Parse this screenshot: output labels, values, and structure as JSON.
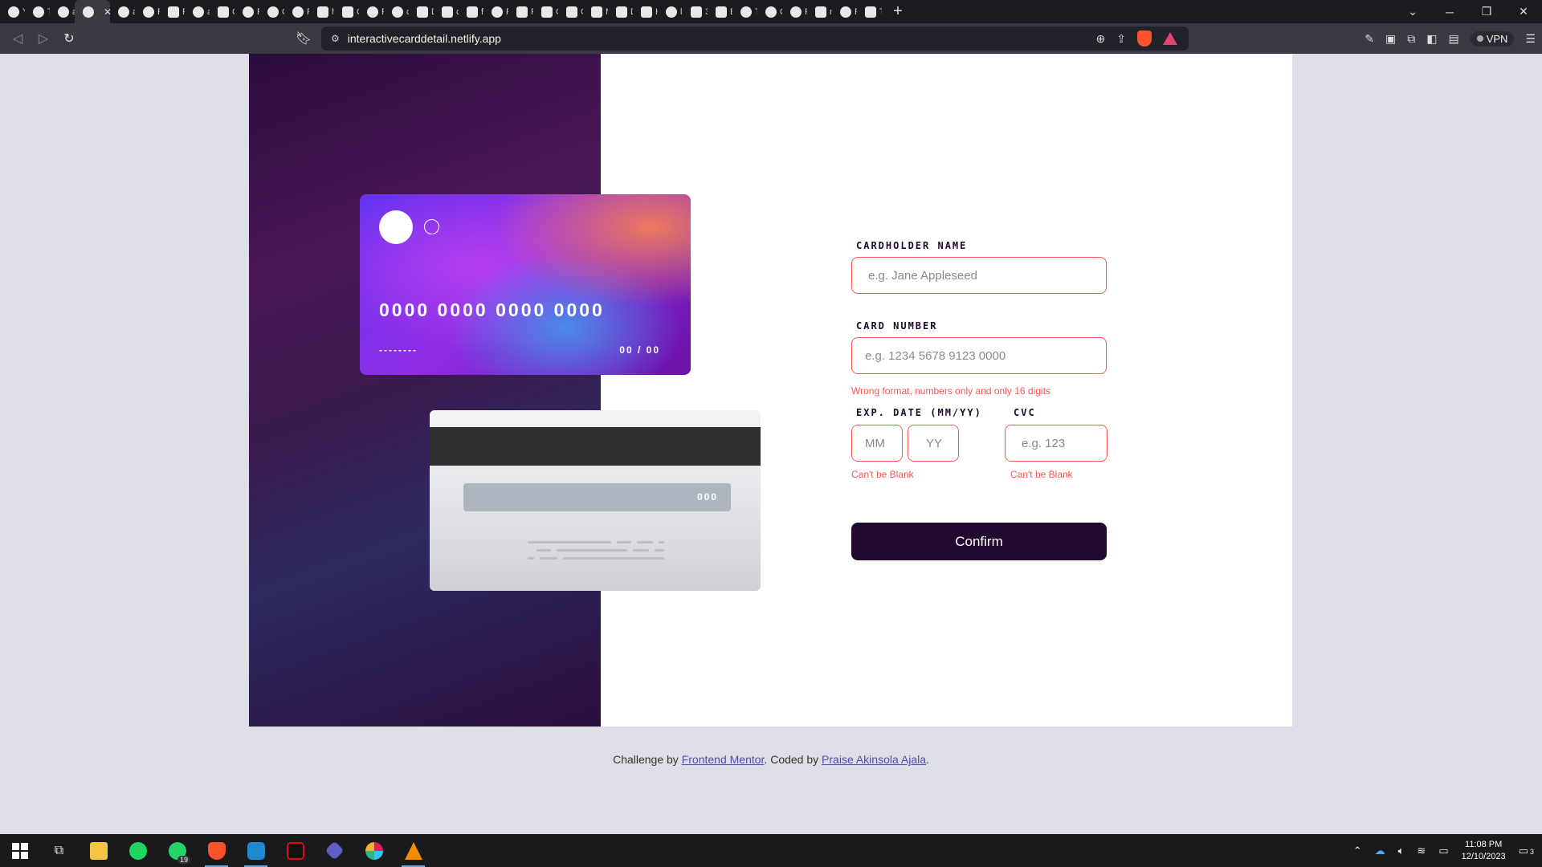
{
  "browser": {
    "tabs": [
      {
        "title": "Yo",
        "icon": "github-icon"
      },
      {
        "title": "Ta",
        "icon": "react-icon"
      },
      {
        "title": "aj",
        "icon": "github-icon"
      },
      {
        "title": "",
        "icon": "netlify-icon",
        "active": true
      },
      {
        "title": "aj",
        "icon": "github-icon"
      },
      {
        "title": "Re",
        "icon": "react-icon"
      },
      {
        "title": "Fr",
        "icon": "frontendmentor-icon"
      },
      {
        "title": "aj",
        "icon": "github-icon"
      },
      {
        "title": "Cc",
        "icon": "vite-icon"
      },
      {
        "title": "Fe",
        "icon": "globe-icon"
      },
      {
        "title": "Cl",
        "icon": "github-icon"
      },
      {
        "title": "Fi",
        "icon": "github-icon"
      },
      {
        "title": "ht",
        "icon": "vercel-icon"
      },
      {
        "title": "Cl",
        "icon": "figma-icon"
      },
      {
        "title": "Re",
        "icon": "react-icon"
      },
      {
        "title": "ch",
        "icon": "globe-icon"
      },
      {
        "title": "D:",
        "icon": "vercel-icon"
      },
      {
        "title": "ch",
        "icon": "app-icon"
      },
      {
        "title": "fa",
        "icon": "app-icon"
      },
      {
        "title": "Re",
        "icon": "chatgpt-icon"
      },
      {
        "title": "Fr",
        "icon": "app-icon"
      },
      {
        "title": "Gi",
        "icon": "vercel-icon"
      },
      {
        "title": "Gi",
        "icon": "vite-icon"
      },
      {
        "title": "M",
        "icon": "figma-icon"
      },
      {
        "title": "D:",
        "icon": "app-icon"
      },
      {
        "title": "H:",
        "icon": "x-icon"
      },
      {
        "title": "lo",
        "icon": "globe-icon"
      },
      {
        "title": "3N",
        "icon": "app-icon"
      },
      {
        "title": "Bi",
        "icon": "app-icon"
      },
      {
        "title": "Te",
        "icon": "globe-icon"
      },
      {
        "title": "O:",
        "icon": "globe-icon"
      },
      {
        "title": "Pr",
        "icon": "globe-icon"
      },
      {
        "title": "m",
        "icon": "vercel-icon"
      },
      {
        "title": "Re",
        "icon": "react-icon"
      },
      {
        "title": "Te",
        "icon": "app-icon"
      }
    ],
    "url": "interactivecarddetail.netlify.app",
    "vpn_label": "VPN"
  },
  "card_front": {
    "number": "0000 0000 0000 0000",
    "name": "--------",
    "expiry": "00 / 00"
  },
  "card_back": {
    "cvc": "000"
  },
  "form": {
    "name_label": "CARDHOLDER NAME",
    "name_placeholder": "e.g. Jane Appleseed",
    "number_label": "CARD NUMBER",
    "number_placeholder": "e.g. 1234 5678 9123 0000",
    "number_error": "Wrong format, numbers only and only 16 digits",
    "exp_label": "EXP. DATE (MM/YY)",
    "month_placeholder": "MM",
    "year_placeholder": "YY",
    "exp_error": "Can't be Blank",
    "cvc_label": "CVC",
    "cvc_placeholder": "e.g. 123",
    "cvc_error": "Can't be Blank",
    "confirm_label": "Confirm"
  },
  "attribution": {
    "prefix": "Challenge by ",
    "link1": "Frontend Mentor",
    "middle": ". Coded by ",
    "link2": "Praise Akinsola Ajala",
    "suffix": "."
  },
  "taskbar": {
    "apps": [
      "windows-start-icon",
      "task-view-icon",
      "file-explorer-icon",
      "spotify-icon",
      "whatsapp-icon",
      "brave-icon",
      "vscode-icon",
      "netflix-icon",
      "app-icon",
      "slack-icon",
      "vlc-icon"
    ],
    "whatsapp_badge": "19",
    "time": "11:08 PM",
    "date": "12/10/2023",
    "notifications": "3"
  },
  "colors": {
    "error": "#ff5252",
    "dark_violet": "#21092f",
    "page_bg": "#dedfe6"
  }
}
